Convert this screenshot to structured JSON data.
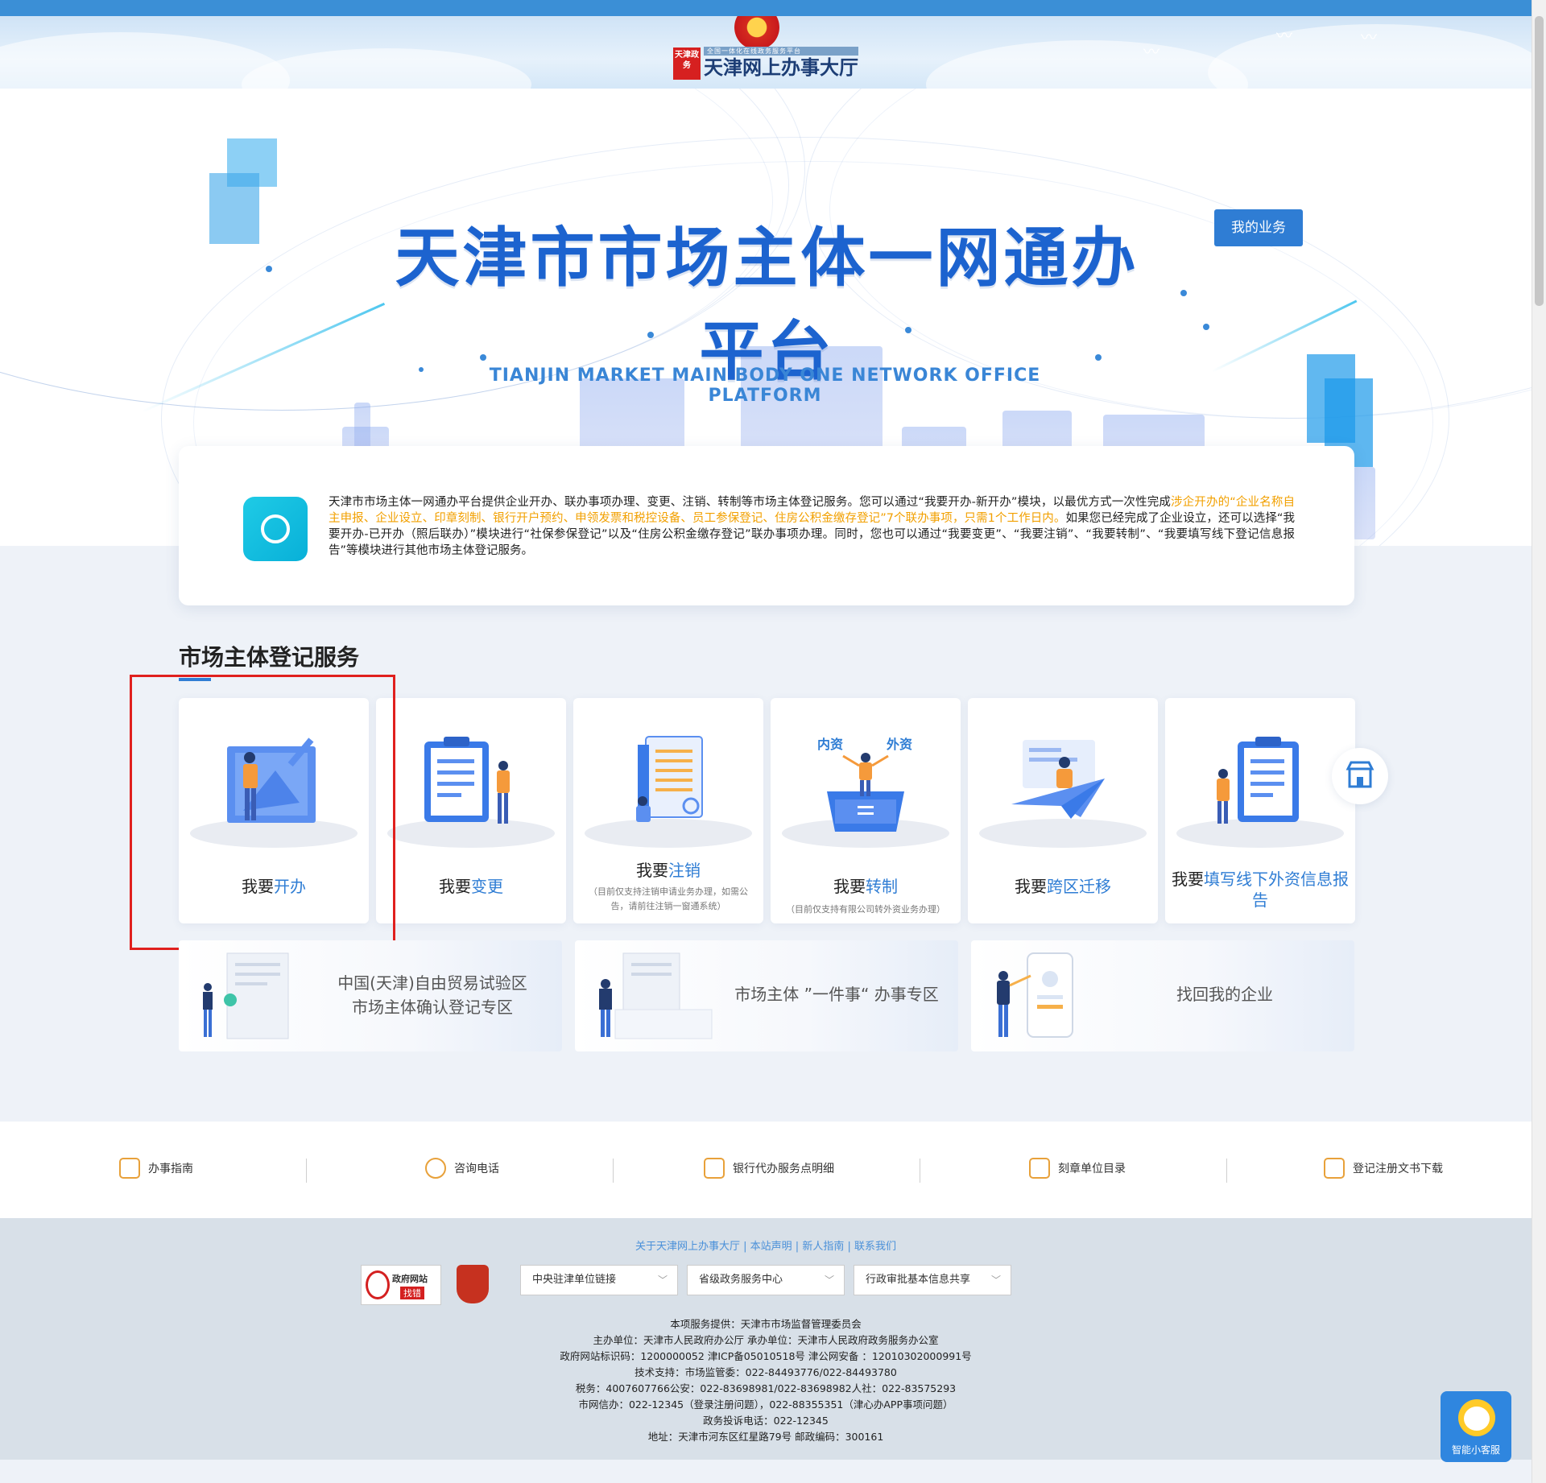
{
  "header": {
    "logo_seal": "天津政务",
    "logo_small": "全国一体化在线政务服务平台",
    "logo_title": "天津网上办事大厅"
  },
  "hero": {
    "title_cn": "天津市市场主体一网通办平台",
    "title_en": "TIANJIN MARKET MAIN BODY ONE NETWORK OFFICE PLATFORM",
    "my_business_button": "我的业务"
  },
  "intro": {
    "text_a": "天津市市场主体一网通办平台提供企业开办、联办事项办理、变更、注销、转制等市场主体登记服务。您可以通过“我要开办-新开办”模块，以最优方式一次性完成",
    "text_highlight": "涉企开办的“企业名称自主申报、企业设立、印章刻制、银行开户预约、申领发票和税控设备、员工参保登记、住房公积金缴存登记”7个联办事项，只需1个工作日内。",
    "text_b": "如果您已经完成了企业设立，还可以选择“我要开办-已开办（照后联办）”模块进行“社保参保登记”以及“住房公积金缴存登记”联办事项办理。同时，您也可以通过“我要变更”、“我要注销”、“我要转制”、“我要填写线下登记信息报告”等模块进行其他市场主体登记服务。"
  },
  "section": {
    "title": "市场主体登记服务"
  },
  "cards": [
    {
      "prefix": "我要",
      "keyword": "开办",
      "note": ""
    },
    {
      "prefix": "我要",
      "keyword": "变更",
      "note": ""
    },
    {
      "prefix": "我要",
      "keyword": "注销",
      "note": "（目前仅支持注销申请业务办理，如需公告，请前往注销一窗通系统）"
    },
    {
      "prefix": "我要",
      "keyword": "转制",
      "note": "（目前仅支持有限公司转外资业务办理）",
      "tag_left": "内资",
      "tag_right": "外资"
    },
    {
      "prefix": "我要",
      "keyword": "跨区迁移",
      "note": ""
    },
    {
      "prefix": "我要",
      "keyword": "填写线下外资信息报告",
      "note": ""
    }
  ],
  "zones": [
    {
      "line1": "中国(天津)自由贸易试验区",
      "line2": "市场主体确认登记专区"
    },
    {
      "line1": "市场主体 ”一件事“ 办事专区",
      "line2": ""
    },
    {
      "line1": "找回我的企业",
      "line2": ""
    }
  ],
  "linkbar": [
    {
      "label": "办事指南",
      "icon": "guide-icon"
    },
    {
      "label": "咨询电话",
      "icon": "phone-icon"
    },
    {
      "label": "银行代办服务点明细",
      "icon": "list-icon"
    },
    {
      "label": "刻章单位目录",
      "icon": "bookmark-icon"
    },
    {
      "label": "登记注册文书下载",
      "icon": "document-icon"
    }
  ],
  "footer": {
    "toplinks": "关于天津网上办事大厅 | 本站声明 | 新人指南 | 联系我们",
    "badge_title": "政府网站",
    "badge_sub": "找错",
    "selects": [
      "中央驻津单位链接",
      "省级政务服务中心",
      "行政审批基本信息共享"
    ],
    "info": [
      "本项服务提供：天津市市场监督管理委员会",
      "主办单位：天津市人民政府办公厅 承办单位：天津市人民政府政务服务办公室",
      "政府网站标识码：1200000052 津ICP备05010518号 津公网安备 ：12010302000991号",
      "技术支持：市场监管委：022-84493776/022-84493780",
      "税务：4007607766公安：022-83698981/022-83698982人社：022-83575293",
      "市网信办：022-12345（登录注册问题），022-88355351（津心办APP事项问题）",
      "政务投诉电话：022-12345",
      "地址：天津市河东区红星路79号 邮政编码：300161"
    ]
  },
  "assistant": {
    "label": "智能小客服"
  },
  "colors": {
    "brand_blue": "#2f7dd4",
    "highlight_orange": "#f2a000",
    "annotation_red": "#e0201e"
  }
}
